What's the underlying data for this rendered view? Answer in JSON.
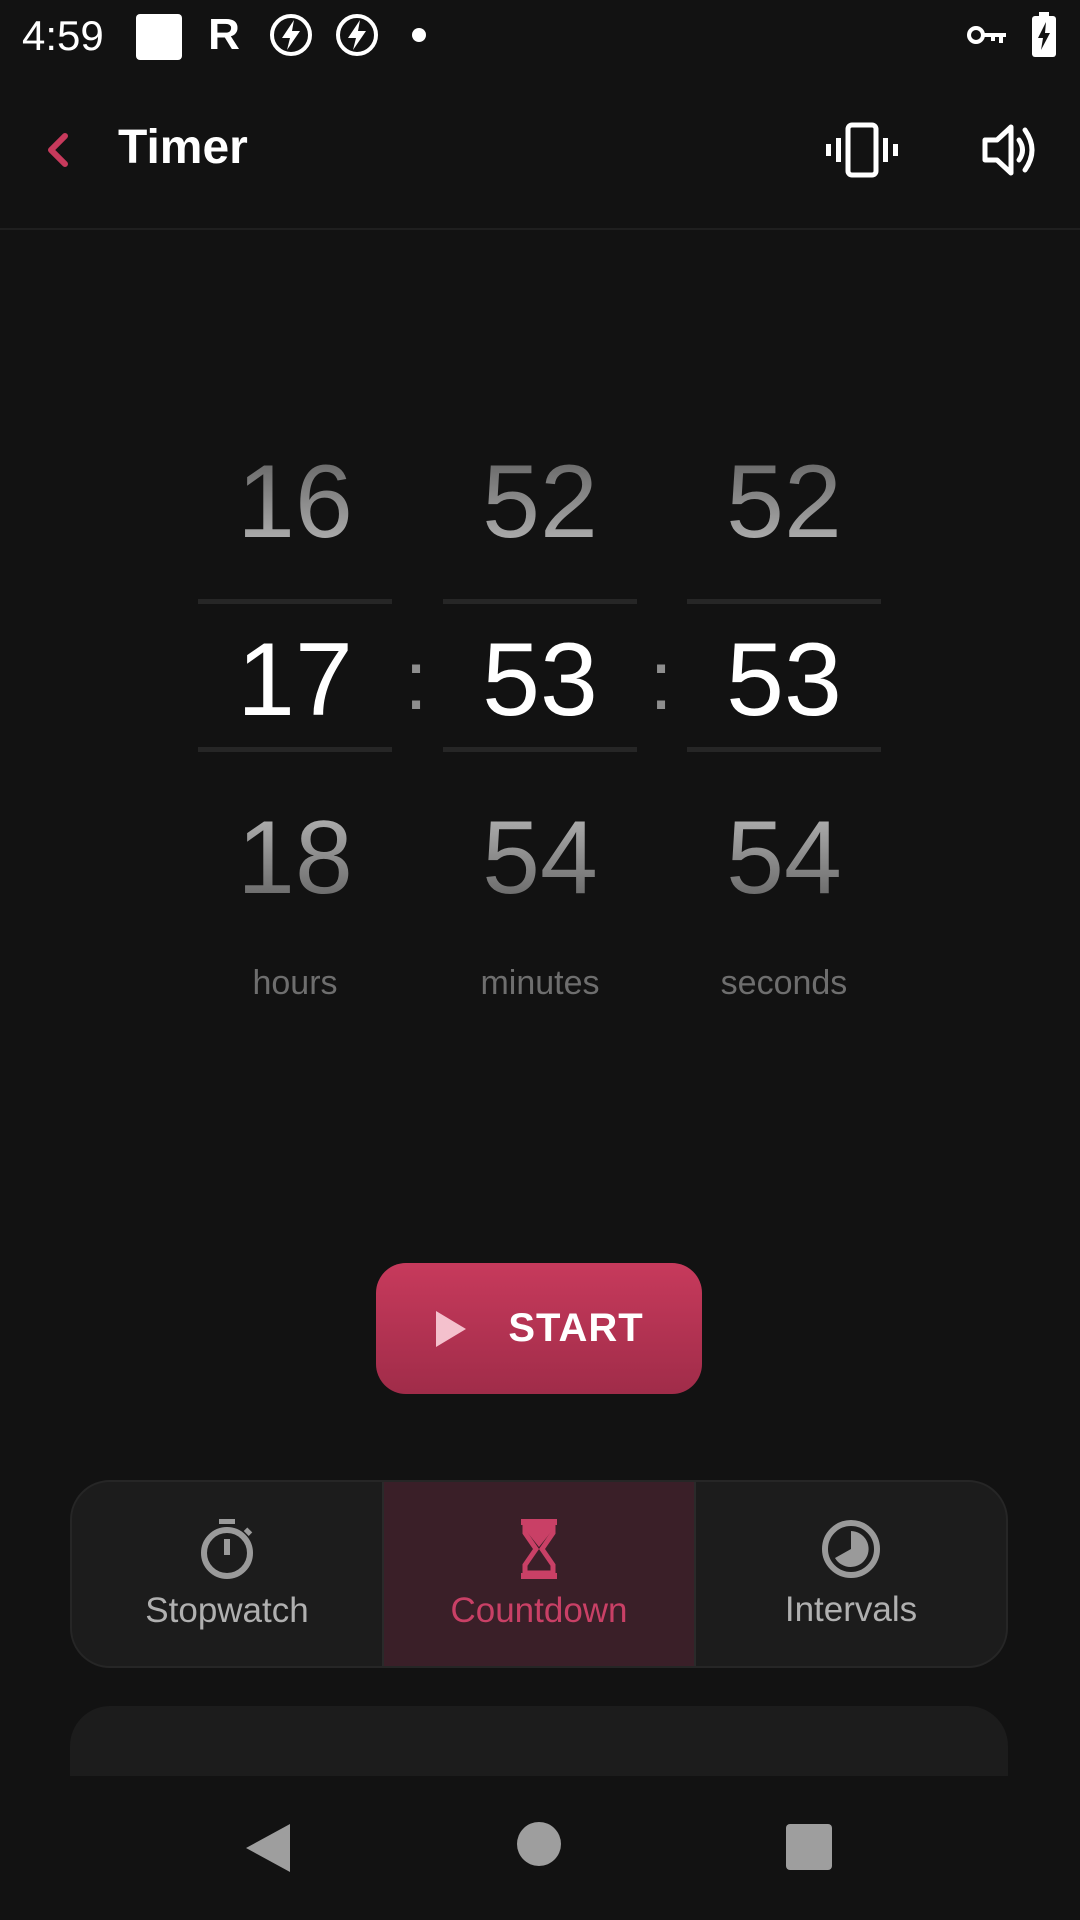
{
  "status_bar": {
    "time": "4:59",
    "icons": [
      "square-notification-icon",
      "r-app-icon",
      "bolt-circle-icon",
      "bolt-circle-icon",
      "dot-icon",
      "vpn-key-icon",
      "battery-charging-icon"
    ],
    "r_glyph": "R"
  },
  "header": {
    "title": "Timer",
    "back_icon": "chevron-left-icon",
    "vibrate_icon": "vibrate-icon",
    "sound_icon": "volume-icon"
  },
  "picker": {
    "hours": {
      "prev": "16",
      "selected": "17",
      "next": "18",
      "unit": "hours"
    },
    "minutes": {
      "prev": "52",
      "selected": "53",
      "next": "54",
      "unit": "minutes"
    },
    "seconds": {
      "prev": "52",
      "selected": "53",
      "next": "54",
      "unit": "seconds"
    },
    "separator": ":"
  },
  "start_button": {
    "label": "START",
    "icon": "play-icon"
  },
  "modes": [
    {
      "label": "Stopwatch",
      "icon": "stopwatch-icon",
      "active": false
    },
    {
      "label": "Countdown",
      "icon": "hourglass-icon",
      "active": true
    },
    {
      "label": "Intervals",
      "icon": "intervals-clock-icon",
      "active": false
    }
  ],
  "colors": {
    "background": "#121212",
    "accent": "#c73a5c",
    "accent_text": "#c94066",
    "active_mode_bg": "#3a1f28",
    "muted_text": "#6e6e6e"
  },
  "nav_bar": {
    "back_icon": "nav-back-icon",
    "home_icon": "nav-home-icon",
    "recents_icon": "nav-recents-icon"
  }
}
